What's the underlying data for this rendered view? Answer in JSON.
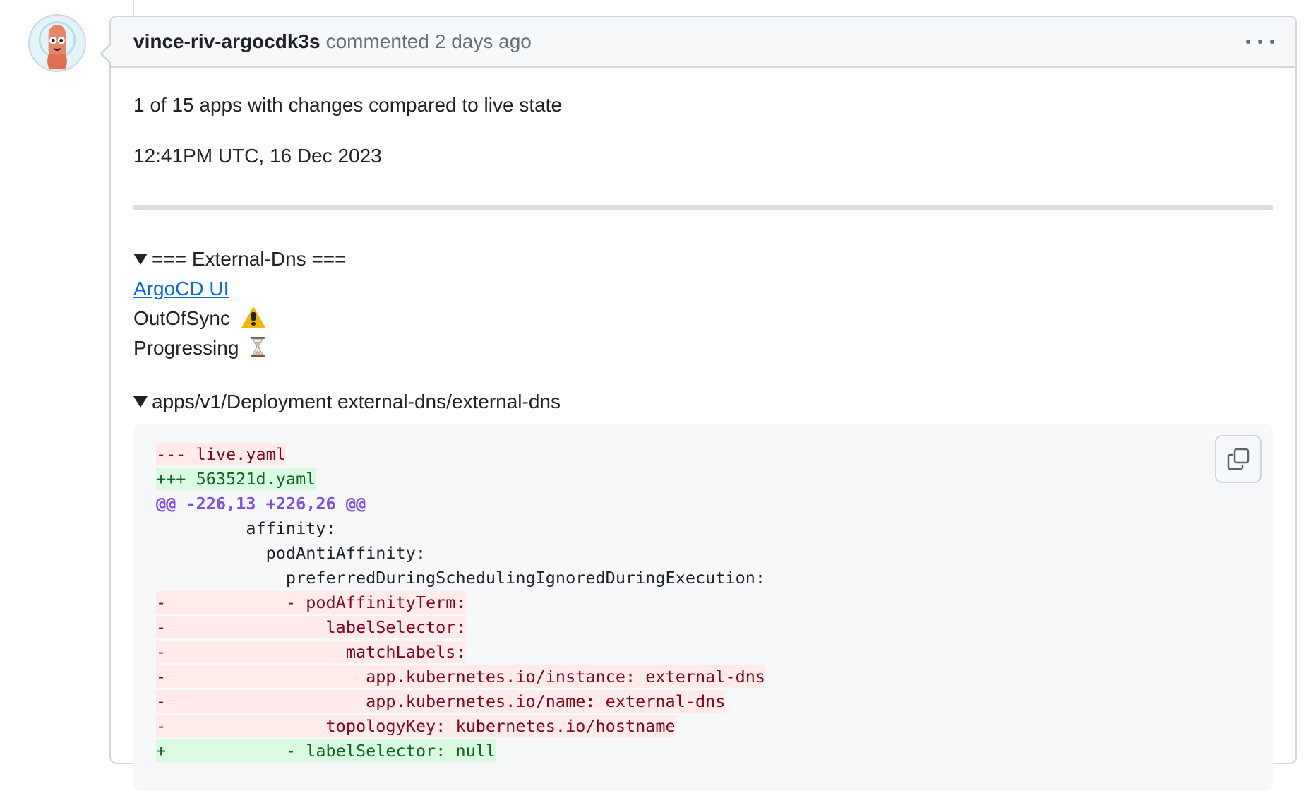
{
  "comment": {
    "author": "vince-riv-argocdk3s",
    "action": "commented",
    "time": "2 days ago"
  },
  "body": {
    "summary": "1 of 15 apps with changes compared to live state",
    "timestamp": "12:41PM UTC, 16 Dec 2023",
    "app_section": {
      "summary": "=== External-Dns ===",
      "link_label": "ArgoCD UI",
      "sync_status": "OutOfSync",
      "health_status": "Progressing"
    },
    "resource_section": {
      "summary": "apps/v1/Deployment external-dns/external-dns"
    }
  },
  "diff_lines": [
    {
      "type": "del",
      "text": "--- live.yaml"
    },
    {
      "type": "add",
      "text": "+++ 563521d.yaml"
    },
    {
      "type": "hunk",
      "text": "@@ -226,13 +226,26 @@"
    },
    {
      "type": "ctx",
      "text": "         affinity:"
    },
    {
      "type": "ctx",
      "text": "           podAntiAffinity:"
    },
    {
      "type": "ctx",
      "text": "             preferredDuringSchedulingIgnoredDuringExecution:"
    },
    {
      "type": "del",
      "text": "-            - podAffinityTerm:"
    },
    {
      "type": "del",
      "text": "-                labelSelector:"
    },
    {
      "type": "del",
      "text": "-                  matchLabels:"
    },
    {
      "type": "del",
      "text": "-                    app.kubernetes.io/instance: external-dns"
    },
    {
      "type": "del",
      "text": "-                    app.kubernetes.io/name: external-dns"
    },
    {
      "type": "del",
      "text": "-                topologyKey: kubernetes.io/hostname"
    },
    {
      "type": "add",
      "text": "+            - labelSelector: null"
    }
  ],
  "icons": {
    "avatar": "argo-octopus-avatar",
    "more": "kebab-horizontal-icon",
    "warning": "warning-emoji-icon",
    "progress": "hourglass-emoji-icon",
    "copy": "copy-icon"
  }
}
